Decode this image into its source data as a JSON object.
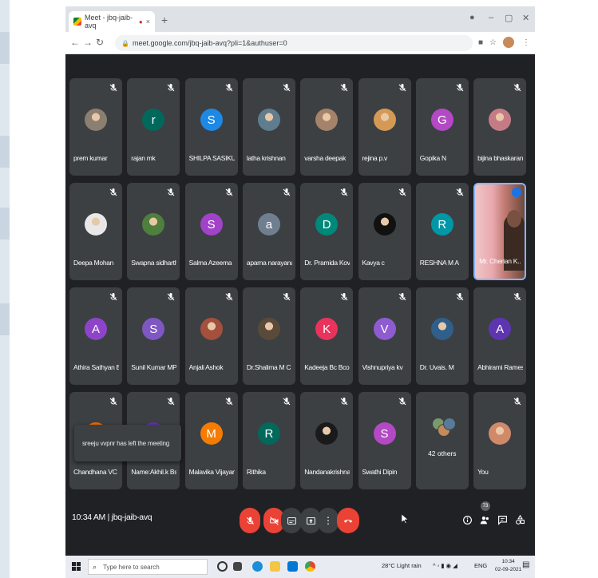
{
  "browser": {
    "tab_title": "Meet - jbq-jaib-avq",
    "tab_close": "×",
    "new_tab": "+",
    "url": "meet.google.com/jbq-jaib-avq?pli=1&authuser=0"
  },
  "participants": [
    {
      "name": "prem kumar",
      "avatar": "photo",
      "color": "#8a7f70"
    },
    {
      "name": "rajan mk",
      "avatar": "r",
      "color": "#00695c"
    },
    {
      "name": "SHILPA SASIKU...",
      "avatar": "S",
      "color": "#1e88e5"
    },
    {
      "name": "latha krishnan",
      "avatar": "photo",
      "color": "#5f7d8e"
    },
    {
      "name": "varsha deepak",
      "avatar": "photo",
      "color": "#a5826a"
    },
    {
      "name": "rejina p.v",
      "avatar": "photo",
      "color": "#d49a55"
    },
    {
      "name": "Gopika N",
      "avatar": "G",
      "color": "#b349c4"
    },
    {
      "name": "bijina bhaskaran",
      "avatar": "photo",
      "color": "#c57b86"
    },
    {
      "name": "Deepa Mohan",
      "avatar": "photo",
      "color": "#e8e8e8"
    },
    {
      "name": "Swapna sidharth",
      "avatar": "photo",
      "color": "#4e7f3d"
    },
    {
      "name": "Salma Azeema",
      "avatar": "S",
      "color": "#a142c9"
    },
    {
      "name": "aparna narayanan",
      "avatar": "a",
      "color": "#6f7f90"
    },
    {
      "name": "Dr. Pramida Kov...",
      "avatar": "D",
      "color": "#00897b"
    },
    {
      "name": "Kavya c",
      "avatar": "photo",
      "color": "#111111"
    },
    {
      "name": "RESHNA M A",
      "avatar": "R",
      "color": "#0097a7"
    },
    {
      "name": "Mr. Cherian K...",
      "avatar": "video",
      "color": "#c07a72"
    },
    {
      "name": "Athira Sathyan B...",
      "avatar": "A",
      "color": "#8e44c9"
    },
    {
      "name": "Sunil Kumar MP",
      "avatar": "S",
      "color": "#7e57c2"
    },
    {
      "name": "Anjali Ashok",
      "avatar": "photo",
      "color": "#a3503c"
    },
    {
      "name": "Dr.Shalima M C",
      "avatar": "photo",
      "color": "#5a4a3a"
    },
    {
      "name": "Kadeeja Bc Bcom",
      "avatar": "K",
      "color": "#e8335c"
    },
    {
      "name": "Vishnupriya kv",
      "avatar": "V",
      "color": "#8e5bd1"
    },
    {
      "name": "Dr. Uvais. M",
      "avatar": "photo",
      "color": "#2f5f8a"
    },
    {
      "name": "Abhirami Rames...",
      "avatar": "A",
      "color": "#5e35b1"
    },
    {
      "name": "Chandhana VC",
      "avatar": "C",
      "color": "#ef6c00"
    },
    {
      "name": "Name:Akhil.k Bs...",
      "avatar": "N",
      "color": "#5e35b1"
    },
    {
      "name": "Malavika Vijayan",
      "avatar": "M",
      "color": "#f57c00"
    },
    {
      "name": "Rithika",
      "avatar": "R",
      "color": "#00695c"
    },
    {
      "name": "Nandanakrishna",
      "avatar": "photo",
      "color": "#1a1a1a"
    },
    {
      "name": "Swathi Dipin",
      "avatar": "S",
      "color": "#b349c4"
    },
    {
      "name": "42 others",
      "avatar": "others",
      "color": "#3c4043"
    },
    {
      "name": "You",
      "avatar": "photo",
      "color": "#d08a6a"
    }
  ],
  "toast": "sreeju vvpnr has left the meeting",
  "meeting": {
    "time": "10:34 AM",
    "separator": "|",
    "code": "jbq-jaib-avq",
    "people_count": "73"
  },
  "taskbar": {
    "search_placeholder": "Type here to search",
    "weather": "28°C  Light rain",
    "lang": "ENG",
    "time": "10:34",
    "date": "02-09-2021"
  },
  "colors": {
    "meet_bg": "#202124",
    "tile_bg": "#3c4043",
    "end_call": "#ea4335",
    "muted_red": "#ea4335"
  }
}
